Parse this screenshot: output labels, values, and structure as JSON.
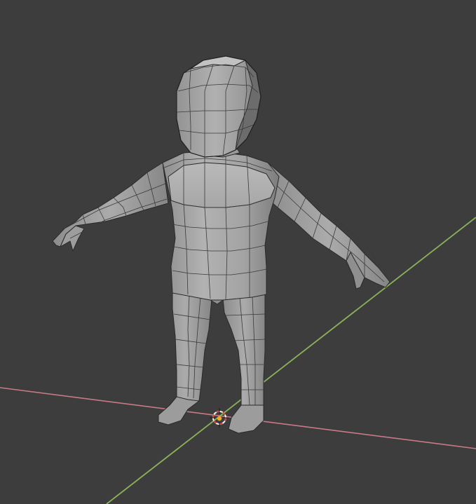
{
  "viewport": {
    "background": "#3d3d3d",
    "grid_visible": true,
    "view": "perspective"
  },
  "axes": {
    "x_axis_color": "#c97a89",
    "y_axis_color": "#8db15a"
  },
  "cursor": {
    "icon": "3d-cursor-icon",
    "ring_color_a": "#d0483c",
    "ring_color_b": "#f2f2f2"
  },
  "origin": {
    "icon": "object-origin-icon",
    "color": "#f5a623"
  },
  "model": {
    "type": "humanoid-base-mesh",
    "shading": "solid",
    "face_color": "#a9a9a9",
    "wire_color": "#2a2a2a"
  }
}
